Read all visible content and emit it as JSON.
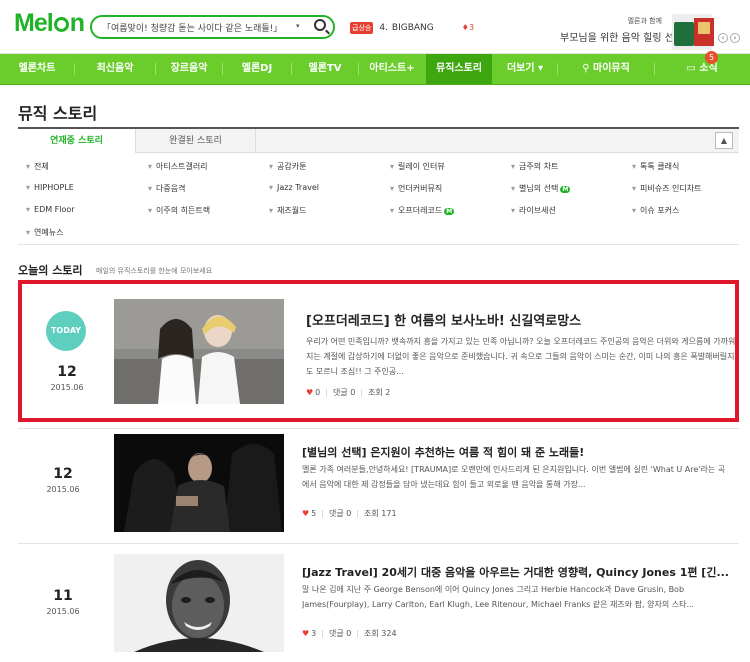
{
  "header": {
    "logo": "Mel",
    "logo_tail": "n",
    "search_value": "「여름맞이! 청량감 돋는 사이다 같은 노래들!」",
    "rank_badge": "급상승",
    "rank_num": "4.",
    "rank_artist": "BIGBANG",
    "rank_change": "♦3",
    "promo_line1": "멜론과 함께",
    "promo_line2": "부모님을 위한 음악 힐링 선물을!",
    "promo_prev": "‹",
    "promo_next": "›"
  },
  "gnb": {
    "items": [
      "멜론차트",
      "최신음악",
      "장르음악",
      "멜론DJ",
      "멜론TV",
      "아티스트+",
      "뮤직스토리",
      "더보기 ▾",
      "마이뮤직",
      "소식"
    ],
    "notice_count": "5"
  },
  "page": {
    "title": "뮤직 스토리",
    "tab_on": "연재중 스토리",
    "tab_off": "완결된 스토리",
    "toggle": "▲"
  },
  "categories": [
    "전체",
    "아티스트갤러리",
    "공감카툰",
    "릴레이 인터뷰",
    "금주의 차트",
    "톡톡 클래식",
    "HIPHOPLE",
    "다중음격",
    "Jazz Travel",
    "언더커버뮤직",
    "별님의 선택",
    "피비슈즈 인디차트",
    "EDM Floor",
    "이주의 히든트랙",
    "재즈월드",
    "오프더레코드",
    "라이브세션",
    "이슈 포커스",
    "연예뉴스"
  ],
  "m_badge": "M",
  "today": {
    "title": "오늘의 스토리",
    "subtitle": "매일의 뮤직스토리를 한눈에 모아보세요"
  },
  "stories": [
    {
      "badge": "TODAY",
      "day": "12",
      "ym": "2015.06",
      "title": "[오프더레코드] 한 여름의 보사노바! 신길역로망스",
      "desc": "우리가 어떤 민족입니까? 뱃속까지 흥을 가지고 있는 민족 아닙니까? 오늘 오프더레코드 주인공의 음악은 더위와 게으름에 가까워지는 계절에 갑상하기에 더없이 좋은 음악으로 준비했습니다. 귀 속으로 그들의 음악이 스미는 순간, 이미 나의 흥은 폭발해버릴지도 모르니 조심!! 그 주인공...",
      "likes": "0",
      "comments": "댓글 0",
      "views": "조회 2"
    },
    {
      "day": "12",
      "ym": "2015.06",
      "title": "[별님의 선택] 은지원이 추천하는 여름 적 힘이 돼 준 노래들!",
      "desc": "멜론 가족 여러분들,안녕하세요! [TRAUMA]로 오랜만에 인사드리게 된 은지원입니다. 이번 앨범에 실린 'What U Are'라는 곡에서 음악에 대한 제 감정들을 담아 냈는데요 힘이 들고 외로울 땐 음악을 통해 가장...",
      "likes": "5",
      "comments": "댓글 0",
      "views": "조회 171"
    },
    {
      "day": "11",
      "ym": "2015.06",
      "title": "[Jazz Travel] 20세기 대중 음악을 아우르는 거대한 영향력, Quincy Jones 1편 [긴...",
      "desc": "말 나온 김에 지난 주 George Benson에 이어 Quincy Jones 그리고 Herbie Hancock과 Dave Grusin, Bob James(Fourplay), Larry Carlton, Earl Klugh, Lee Ritenour, Michael Franks 같은 재즈와 팝, 양자의 스타...",
      "likes": "3",
      "comments": "댓글 0",
      "views": "조회 324"
    }
  ],
  "colors": {
    "accent": "#21b327",
    "gnb": "#6bcd2b",
    "highlight": "#e0162b",
    "today_badge": "#5ecfbf"
  }
}
